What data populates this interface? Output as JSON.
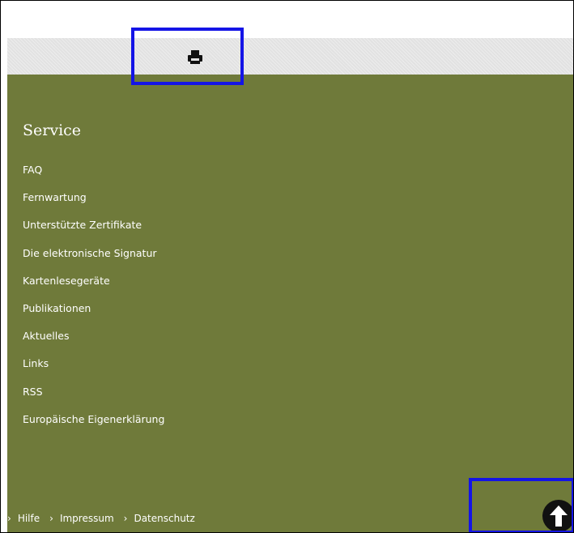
{
  "toolbar": {
    "print_icon": "print-icon"
  },
  "footer": {
    "heading": "Service",
    "items": [
      {
        "label": "FAQ"
      },
      {
        "label": "Fernwartung"
      },
      {
        "label": "Unterstützte Zertifikate"
      },
      {
        "label": "Die elektronische Signatur"
      },
      {
        "label": "Kartenlesegeräte"
      },
      {
        "label": "Publikationen"
      },
      {
        "label": "Aktuelles"
      },
      {
        "label": "Links"
      },
      {
        "label": "RSS"
      },
      {
        "label": "Europäische Eigenerklärung"
      }
    ],
    "bottom_links": [
      {
        "label": "Hilfe"
      },
      {
        "label": "Impressum"
      },
      {
        "label": "Datenschutz"
      }
    ],
    "back_to_top_icon": "arrow-up-icon"
  },
  "colors": {
    "footer_bg": "#6f7a3a",
    "print_bar_bg": "#e2e2e2",
    "highlight": "#1414e6"
  }
}
